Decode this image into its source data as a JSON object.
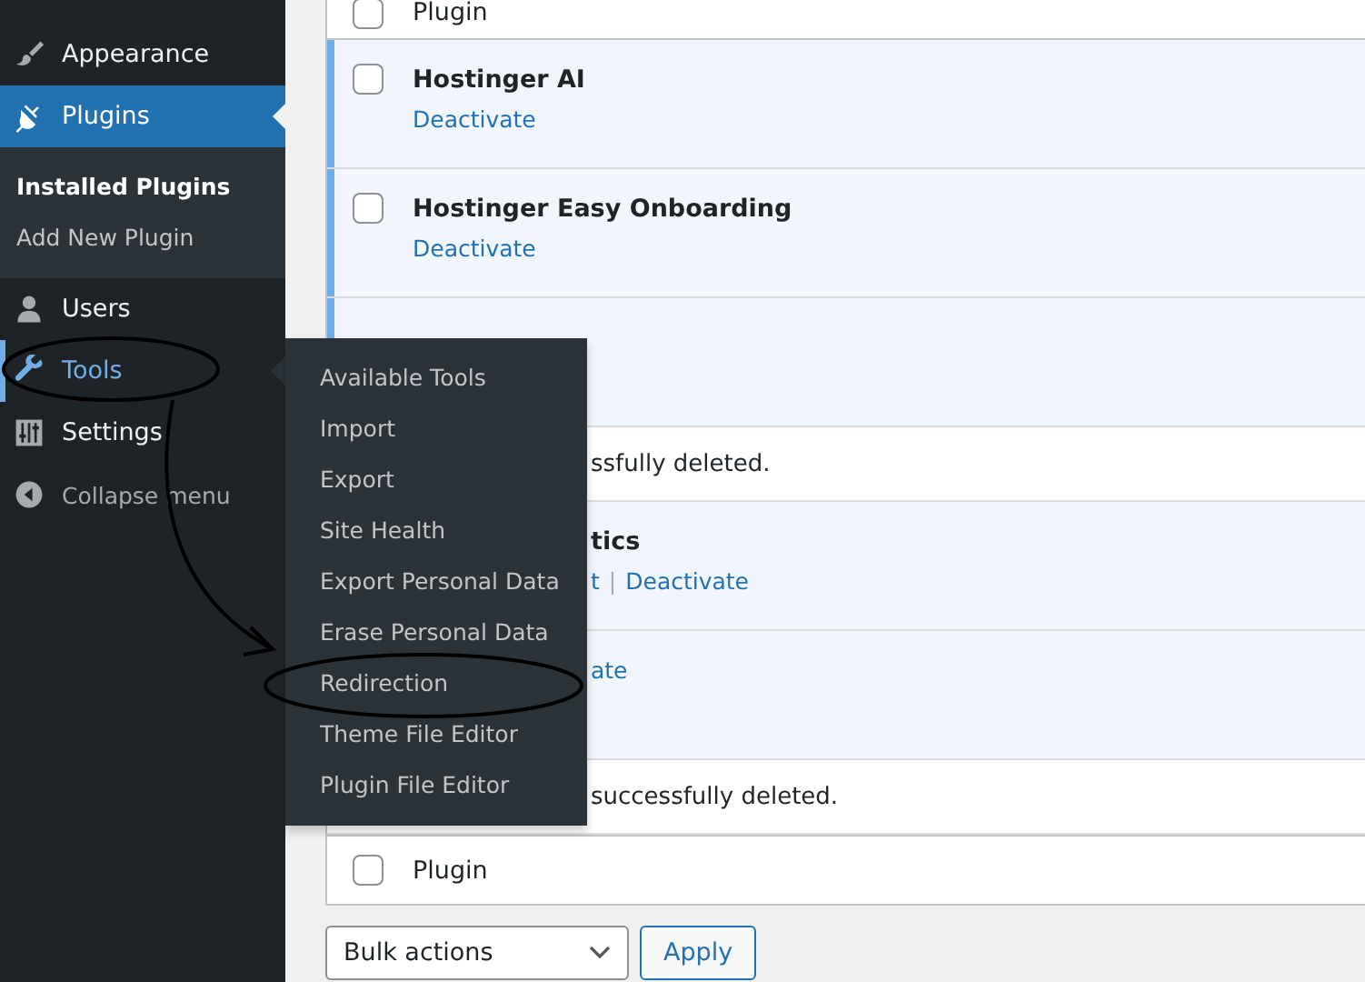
{
  "sidebar": {
    "items": [
      {
        "label": "Appearance",
        "kind": "menu",
        "selected": false,
        "highlighted": false
      },
      {
        "label": "Plugins",
        "kind": "menu",
        "selected": true,
        "highlighted": false,
        "children": [
          {
            "label": "Installed Plugins",
            "selected": true
          },
          {
            "label": "Add New Plugin",
            "selected": false
          }
        ]
      },
      {
        "label": "Users",
        "kind": "menu",
        "selected": false,
        "highlighted": false
      },
      {
        "label": "Tools",
        "kind": "menu",
        "selected": false,
        "highlighted": true
      },
      {
        "label": "Settings",
        "kind": "menu",
        "selected": false,
        "highlighted": false
      },
      {
        "label": "Collapse menu",
        "kind": "collapse",
        "selected": false,
        "highlighted": false
      }
    ]
  },
  "flyout": {
    "items": [
      {
        "label": "Available Tools"
      },
      {
        "label": "Import"
      },
      {
        "label": "Export"
      },
      {
        "label": "Site Health"
      },
      {
        "label": "Export Personal Data"
      },
      {
        "label": "Erase Personal Data"
      },
      {
        "label": "Redirection"
      },
      {
        "label": "Theme File Editor"
      },
      {
        "label": "Plugin File Editor"
      }
    ]
  },
  "table": {
    "header": {
      "label": "Plugin",
      "checked": false
    },
    "action_separator": "|",
    "rows": [
      {
        "kind": "plugin",
        "active": true,
        "covered": false,
        "checked": false,
        "name": "Hostinger AI",
        "actions": [
          {
            "label": "Deactivate"
          }
        ]
      },
      {
        "kind": "plugin",
        "active": true,
        "covered": false,
        "checked": false,
        "name": "Hostinger Easy Onboarding",
        "actions": [
          {
            "label": "Deactivate"
          }
        ]
      },
      {
        "kind": "plugin",
        "active": true,
        "covered": true,
        "actions": []
      },
      {
        "kind": "notice",
        "active": false,
        "covered": true,
        "text": "ssfully deleted."
      },
      {
        "kind": "plugin",
        "active": true,
        "covered": true,
        "name": "tics",
        "actions": [
          {
            "label": "t"
          },
          {
            "label": "Deactivate"
          }
        ]
      },
      {
        "kind": "plugin",
        "active": true,
        "covered": true,
        "actions": [
          {
            "label": "ate"
          }
        ]
      },
      {
        "kind": "notice",
        "active": false,
        "covered": true,
        "text": "successfully deleted."
      }
    ],
    "footer": {
      "label": "Plugin",
      "checked": false
    }
  },
  "bulk": {
    "value": "Bulk actions",
    "button": "Apply"
  }
}
